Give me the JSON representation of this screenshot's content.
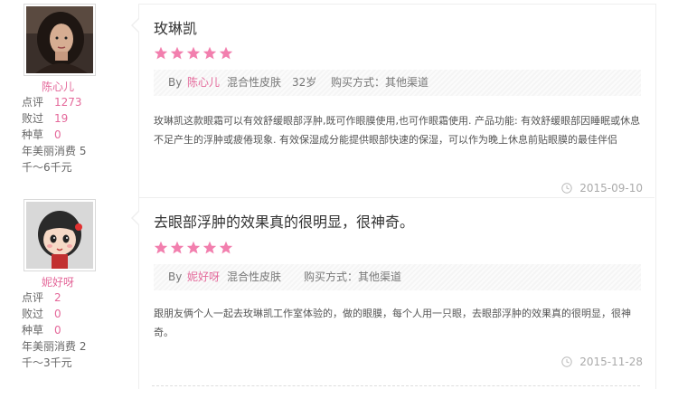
{
  "reviews": [
    {
      "user": {
        "name": "陈心儿",
        "avatar_icon": "woman-portrait-avatar",
        "stats": [
          {
            "label": "点评",
            "value": "1273"
          },
          {
            "label": "败过",
            "value": "19"
          },
          {
            "label": "种草",
            "value": "0"
          }
        ],
        "spending": "年美丽消费 5千～6千元"
      },
      "title": "玫琳凯",
      "rating": 5,
      "meta": {
        "by": "By",
        "username": "陈心儿",
        "skin_type": "混合性皮肤",
        "age": "32岁",
        "purchase": "购买方式：其他渠道"
      },
      "content": "玫琳凯这款眼霜可以有效舒缓眼部浮肿,既可作眼膜使用,也可作眼霜使用. 产品功能: 有效舒缓眼部因睡眠或休息不足产生的浮肿或疲倦现象. 有效保湿成分能提供眼部快速的保湿，可以作为晚上休息前贴眼膜的最佳伴侣",
      "date": "2015-09-10"
    },
    {
      "user": {
        "name": "妮好呀",
        "avatar_icon": "cartoon-girl-avatar",
        "stats": [
          {
            "label": "点评",
            "value": "2"
          },
          {
            "label": "败过",
            "value": "0"
          },
          {
            "label": "种草",
            "value": "0"
          }
        ],
        "spending": "年美丽消费 2千～3千元"
      },
      "title": "去眼部浮肿的效果真的很明显，很神奇。",
      "rating": 5,
      "meta": {
        "by": "By",
        "username": "妮好呀",
        "skin_type": "混合性皮肤",
        "age": "",
        "purchase": "购买方式：其他渠道"
      },
      "content": "跟朋友俩个人一起去玫琳凯工作室体验的，做的眼膜，每个人用一只眼，去眼部浮肿的效果真的很明显，很神奇。",
      "date": "2015-11-28"
    }
  ],
  "colors": {
    "accent": "#e4689a",
    "star": "#f27fae",
    "muted": "#aaaaaa"
  }
}
